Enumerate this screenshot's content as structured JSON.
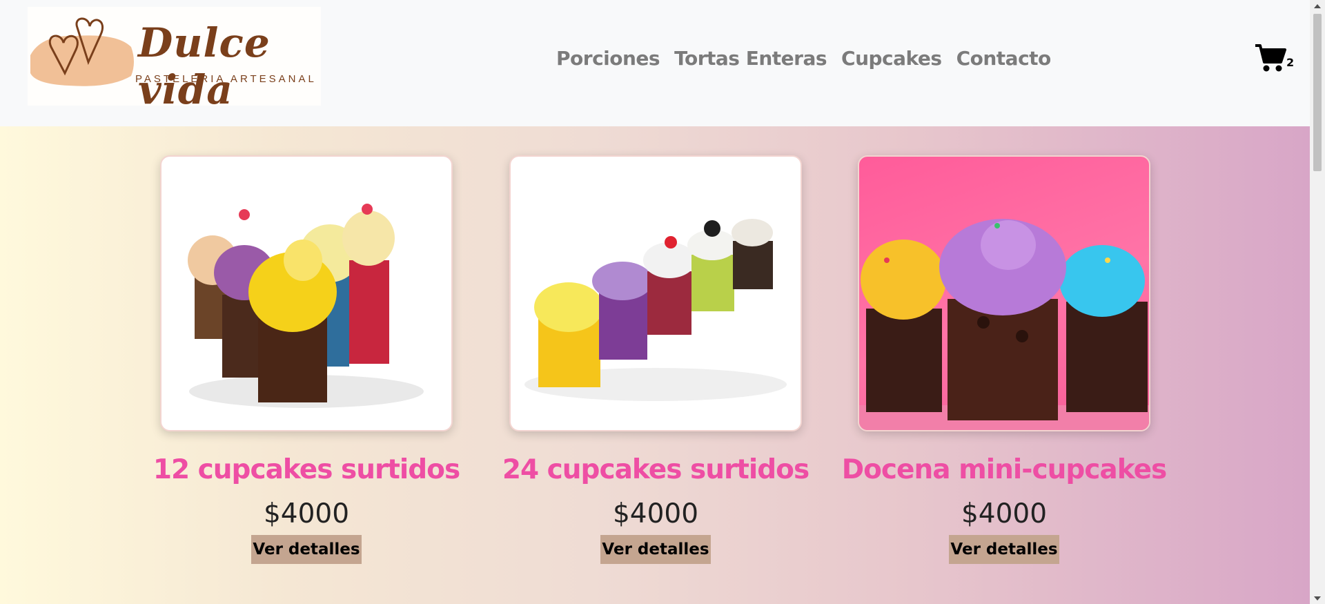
{
  "brand": {
    "title": "Dulce vida",
    "subtitle": "PASTELERIA ARTESANAL"
  },
  "nav": {
    "items": [
      {
        "label": "Porciones"
      },
      {
        "label": "Tortas Enteras"
      },
      {
        "label": "Cupcakes"
      },
      {
        "label": "Contacto"
      }
    ]
  },
  "cart": {
    "icon": "shopping-cart-icon",
    "count": "2"
  },
  "products": [
    {
      "title": "12 cupcakes surtidos",
      "price": "$4000",
      "button": "Ver detalles",
      "image": "assorted-cupcakes-photo"
    },
    {
      "title": "24 cupcakes surtidos",
      "price": "$4000",
      "button": "Ver detalles",
      "image": "cupcakes-row-photo"
    },
    {
      "title": "Docena mini-cupcakes",
      "price": "$4000",
      "button": "Ver detalles",
      "image": "mini-cupcakes-pink-photo"
    }
  ],
  "colors": {
    "accent_title": "#ee4ea4",
    "button_bg": "#c4a590",
    "nav_text": "#7b7b7b",
    "brand_brown": "#7a3f1b"
  }
}
